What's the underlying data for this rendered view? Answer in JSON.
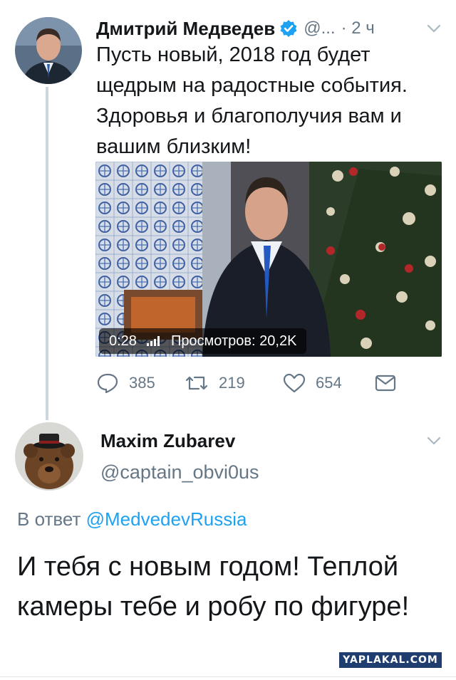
{
  "tweet1": {
    "author_name": "Дмитрий Медведев",
    "verified_icon": "verified-badge-icon",
    "handle": "@...",
    "time": "· 2 ч",
    "text": "Пусть новый, 2018 год будет щедрым на радостные события. Здоровья и благополучия вам и вашим близким!",
    "video": {
      "duration": "0:28",
      "views": "Просмотров: 20,2K"
    },
    "actions": {
      "replies": "385",
      "retweets": "219",
      "likes": "654"
    }
  },
  "tweet2": {
    "author_name": "Maxim Zubarev",
    "handle": "@captain_obvi0us",
    "reply_prefix": "В ответ",
    "reply_mention": "@MedvedevRussia",
    "text": "И тебя с новым годом! Теплой камеры тебе и робу по фигуре!"
  },
  "watermark": "YAPLAKAL.COM",
  "colors": {
    "accent": "#1da1f2",
    "secondary_text": "#657786",
    "primary_text": "#14171a",
    "thread_line": "#ccd6dd"
  }
}
